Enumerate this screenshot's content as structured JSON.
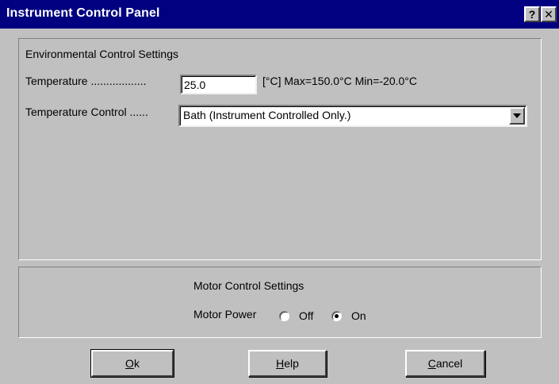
{
  "window": {
    "title": "Instrument Control Panel",
    "help_glyph": "?",
    "close_glyph": "✕"
  },
  "environment": {
    "heading": "Environmental Control Settings",
    "temperature_label": "Temperature ..................",
    "temperature_value": "25.0",
    "temperature_range": "[°C] Max=150.0°C  Min=-20.0°C",
    "control_label": "Temperature Control ......",
    "control_selected": "Bath (Instrument Controlled Only.)"
  },
  "motor": {
    "heading": "Motor Control Settings",
    "power_label": "Motor Power",
    "off_label": "Off",
    "on_label": "On",
    "selected": "On"
  },
  "buttons": {
    "ok_mnemonic": "O",
    "ok_rest": "k",
    "help_mnemonic": "H",
    "help_rest": "elp",
    "cancel_mnemonic": "C",
    "cancel_rest": "ancel"
  },
  "colors": {
    "titlebar": "#000080",
    "face": "#c0c0c0"
  }
}
